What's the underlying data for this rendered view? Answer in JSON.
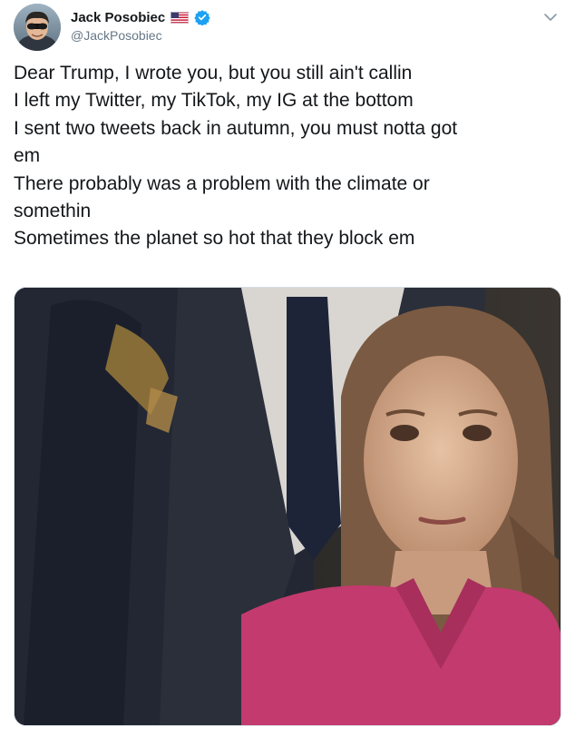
{
  "tweet": {
    "author": {
      "display_name": "Jack Posobiec",
      "handle": "@JackPosobiec",
      "badges": [
        "us-flag-icon",
        "verified-icon"
      ]
    },
    "text_lines": [
      "Dear Trump, I wrote you, but you still ain't callin",
      "I left my Twitter, my TikTok, my IG at the bottom",
      "I sent two tweets back in autumn, you must notta got",
      "em",
      "There probably was a problem with the climate or",
      "somethin",
      "Sometimes the planet so hot that they block em"
    ],
    "media": {
      "type": "photo",
      "description_icon": "photo-icon"
    },
    "menu_icon": "chevron-down-icon"
  },
  "colors": {
    "name": "#14171a",
    "handle": "#657786",
    "verified": "#1da1f2",
    "shirt": "#c23a6e"
  }
}
